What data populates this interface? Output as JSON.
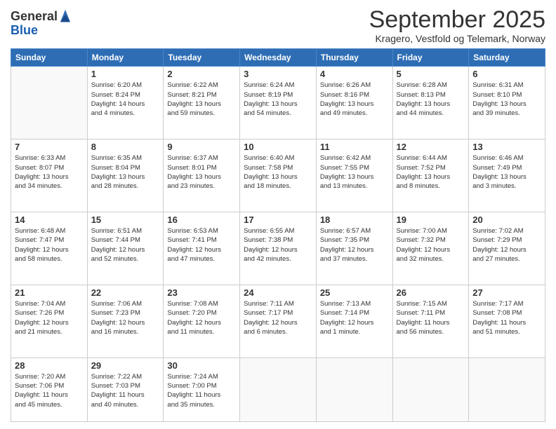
{
  "logo": {
    "general": "General",
    "blue": "Blue"
  },
  "header": {
    "month": "September 2025",
    "location": "Kragero, Vestfold og Telemark, Norway"
  },
  "weekdays": [
    "Sunday",
    "Monday",
    "Tuesday",
    "Wednesday",
    "Thursday",
    "Friday",
    "Saturday"
  ],
  "weeks": [
    [
      {
        "day": "",
        "info": ""
      },
      {
        "day": "1",
        "info": "Sunrise: 6:20 AM\nSunset: 8:24 PM\nDaylight: 14 hours\nand 4 minutes."
      },
      {
        "day": "2",
        "info": "Sunrise: 6:22 AM\nSunset: 8:21 PM\nDaylight: 13 hours\nand 59 minutes."
      },
      {
        "day": "3",
        "info": "Sunrise: 6:24 AM\nSunset: 8:19 PM\nDaylight: 13 hours\nand 54 minutes."
      },
      {
        "day": "4",
        "info": "Sunrise: 6:26 AM\nSunset: 8:16 PM\nDaylight: 13 hours\nand 49 minutes."
      },
      {
        "day": "5",
        "info": "Sunrise: 6:28 AM\nSunset: 8:13 PM\nDaylight: 13 hours\nand 44 minutes."
      },
      {
        "day": "6",
        "info": "Sunrise: 6:31 AM\nSunset: 8:10 PM\nDaylight: 13 hours\nand 39 minutes."
      }
    ],
    [
      {
        "day": "7",
        "info": "Sunrise: 6:33 AM\nSunset: 8:07 PM\nDaylight: 13 hours\nand 34 minutes."
      },
      {
        "day": "8",
        "info": "Sunrise: 6:35 AM\nSunset: 8:04 PM\nDaylight: 13 hours\nand 28 minutes."
      },
      {
        "day": "9",
        "info": "Sunrise: 6:37 AM\nSunset: 8:01 PM\nDaylight: 13 hours\nand 23 minutes."
      },
      {
        "day": "10",
        "info": "Sunrise: 6:40 AM\nSunset: 7:58 PM\nDaylight: 13 hours\nand 18 minutes."
      },
      {
        "day": "11",
        "info": "Sunrise: 6:42 AM\nSunset: 7:55 PM\nDaylight: 13 hours\nand 13 minutes."
      },
      {
        "day": "12",
        "info": "Sunrise: 6:44 AM\nSunset: 7:52 PM\nDaylight: 13 hours\nand 8 minutes."
      },
      {
        "day": "13",
        "info": "Sunrise: 6:46 AM\nSunset: 7:49 PM\nDaylight: 13 hours\nand 3 minutes."
      }
    ],
    [
      {
        "day": "14",
        "info": "Sunrise: 6:48 AM\nSunset: 7:47 PM\nDaylight: 12 hours\nand 58 minutes."
      },
      {
        "day": "15",
        "info": "Sunrise: 6:51 AM\nSunset: 7:44 PM\nDaylight: 12 hours\nand 52 minutes."
      },
      {
        "day": "16",
        "info": "Sunrise: 6:53 AM\nSunset: 7:41 PM\nDaylight: 12 hours\nand 47 minutes."
      },
      {
        "day": "17",
        "info": "Sunrise: 6:55 AM\nSunset: 7:38 PM\nDaylight: 12 hours\nand 42 minutes."
      },
      {
        "day": "18",
        "info": "Sunrise: 6:57 AM\nSunset: 7:35 PM\nDaylight: 12 hours\nand 37 minutes."
      },
      {
        "day": "19",
        "info": "Sunrise: 7:00 AM\nSunset: 7:32 PM\nDaylight: 12 hours\nand 32 minutes."
      },
      {
        "day": "20",
        "info": "Sunrise: 7:02 AM\nSunset: 7:29 PM\nDaylight: 12 hours\nand 27 minutes."
      }
    ],
    [
      {
        "day": "21",
        "info": "Sunrise: 7:04 AM\nSunset: 7:26 PM\nDaylight: 12 hours\nand 21 minutes."
      },
      {
        "day": "22",
        "info": "Sunrise: 7:06 AM\nSunset: 7:23 PM\nDaylight: 12 hours\nand 16 minutes."
      },
      {
        "day": "23",
        "info": "Sunrise: 7:08 AM\nSunset: 7:20 PM\nDaylight: 12 hours\nand 11 minutes."
      },
      {
        "day": "24",
        "info": "Sunrise: 7:11 AM\nSunset: 7:17 PM\nDaylight: 12 hours\nand 6 minutes."
      },
      {
        "day": "25",
        "info": "Sunrise: 7:13 AM\nSunset: 7:14 PM\nDaylight: 12 hours\nand 1 minute."
      },
      {
        "day": "26",
        "info": "Sunrise: 7:15 AM\nSunset: 7:11 PM\nDaylight: 11 hours\nand 56 minutes."
      },
      {
        "day": "27",
        "info": "Sunrise: 7:17 AM\nSunset: 7:08 PM\nDaylight: 11 hours\nand 51 minutes."
      }
    ],
    [
      {
        "day": "28",
        "info": "Sunrise: 7:20 AM\nSunset: 7:06 PM\nDaylight: 11 hours\nand 45 minutes."
      },
      {
        "day": "29",
        "info": "Sunrise: 7:22 AM\nSunset: 7:03 PM\nDaylight: 11 hours\nand 40 minutes."
      },
      {
        "day": "30",
        "info": "Sunrise: 7:24 AM\nSunset: 7:00 PM\nDaylight: 11 hours\nand 35 minutes."
      },
      {
        "day": "",
        "info": ""
      },
      {
        "day": "",
        "info": ""
      },
      {
        "day": "",
        "info": ""
      },
      {
        "day": "",
        "info": ""
      }
    ]
  ]
}
